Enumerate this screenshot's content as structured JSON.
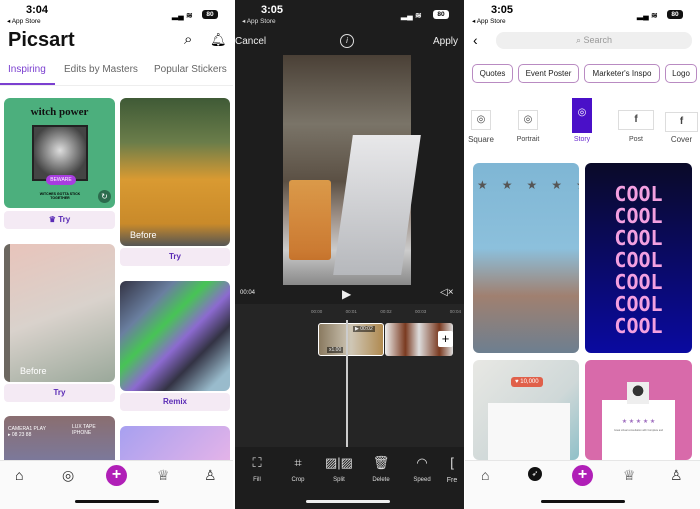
{
  "screens": [
    {
      "status": {
        "time": "3:04",
        "back": "◂ App Store",
        "battery": "80"
      },
      "logo": "Picsart",
      "tabs": [
        {
          "label": "Inspiring",
          "active": true
        },
        {
          "label": "Edits by Masters"
        },
        {
          "label": "Popular Stickers"
        }
      ],
      "cards": {
        "witch_title": "witch power",
        "witch_badge": "BEWARE",
        "witch_caption": "WITCHES GOTTA STICK TOGETHER",
        "try1": "Try",
        "before1": "Before",
        "try2": "Try",
        "before2": "Before",
        "try3": "Try",
        "remix": "Remix",
        "vhs": "CAMERA1 PLAY ▸ 08 23 88",
        "vhs2": "LUX TAPE IPHONE"
      },
      "nav": [
        "home",
        "explore",
        "create",
        "challenges",
        "profile"
      ]
    },
    {
      "status": {
        "time": "3:05",
        "back": "◂ App Store",
        "battery": "80"
      },
      "cancel": "Cancel",
      "apply": "Apply",
      "current_time": "00:04",
      "ruler": [
        "00:00",
        "00:01",
        "00:02",
        "00:03",
        "00:04"
      ],
      "clip_duration": "▶ 00:02",
      "clip_speed": "x1.00",
      "tools": [
        {
          "label": "Fill",
          "icon": "fill-icon"
        },
        {
          "label": "Crop",
          "icon": "crop-icon"
        },
        {
          "label": "Split",
          "icon": "split-icon"
        },
        {
          "label": "Delete",
          "icon": "trash-icon"
        },
        {
          "label": "Speed",
          "icon": "speedometer-icon"
        },
        {
          "label": "Fre",
          "icon": "freeze-icon"
        }
      ]
    },
    {
      "status": {
        "time": "3:05",
        "back": "◂ App Store",
        "battery": "80"
      },
      "search_placeholder": "Search",
      "chips": [
        "Quotes",
        "Event Poster",
        "Marketer's Inspo",
        "Logo"
      ],
      "formats": [
        {
          "label": "Square",
          "icon": "instagram-icon"
        },
        {
          "label": "Portrait",
          "icon": "instagram-icon"
        },
        {
          "label": "Story",
          "icon": "instagram-icon",
          "active": true
        },
        {
          "label": "Post",
          "icon": "facebook-icon"
        },
        {
          "label": "Cover",
          "icon": "facebook-icon"
        }
      ],
      "cool_text": "COOL",
      "likes": "10,000",
      "review": "Great virtual consultation with Complete and"
    }
  ],
  "colors": {
    "accent": "#7b3fd0",
    "create": "#b01fb7",
    "story_active": "#4a10c8",
    "editor_bg": "#1d1d1d"
  }
}
